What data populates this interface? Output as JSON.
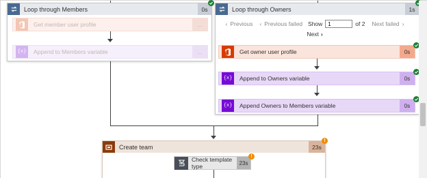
{
  "loop_members": {
    "title": "Loop through Members",
    "duration": "0s",
    "actions": [
      {
        "label": "Get member user profile",
        "duration": "..."
      },
      {
        "label": "Append to Members variable",
        "duration": "..."
      }
    ]
  },
  "loop_owners": {
    "title": "Loop through Owners",
    "duration": "1s",
    "pager": {
      "previous": "Previous",
      "previous_failed": "Previous failed",
      "show_label": "Show",
      "current_value": "1",
      "of_total": "of 2",
      "next_failed": "Next failed",
      "next": "Next"
    },
    "actions": [
      {
        "label": "Get owner user profile",
        "duration": "0s"
      },
      {
        "label": "Append to Owners variable",
        "duration": "0s"
      },
      {
        "label": "Append Owners to Members variable",
        "duration": "0s"
      }
    ]
  },
  "create_team": {
    "title": "Create team",
    "duration": "23s",
    "child": {
      "label": "Check template type",
      "duration": "23s"
    }
  },
  "colors": {
    "office_orange": "#d83b01",
    "variable_purple": "#770bd6",
    "scope_blue": "#486991",
    "success_green": "#1e7d34",
    "warning_orange": "#f08c00"
  }
}
